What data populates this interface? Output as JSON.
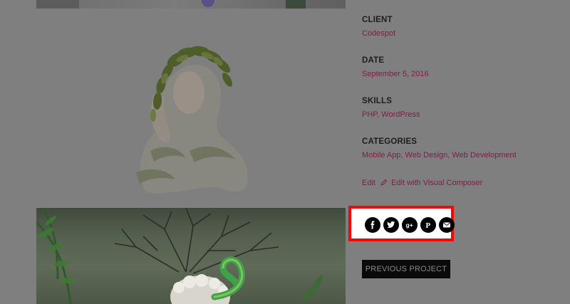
{
  "project_meta": {
    "client": {
      "label": "CLIENT",
      "value": "Codespot"
    },
    "date": {
      "label": "DATE",
      "value": "September 5, 2016"
    },
    "skills": {
      "label": "SKILLS",
      "value": "PHP, WordPress"
    },
    "categories": {
      "label": "CATEGORIES",
      "value": "Mobile App, Web Design, Web Development"
    }
  },
  "edit": {
    "edit_label": "Edit",
    "visual_composer_label": "Edit with Visual Composer"
  },
  "share": {
    "icons": [
      "facebook-icon",
      "twitter-icon",
      "google-plus-icon",
      "pinterest-icon",
      "email-icon"
    ],
    "highlight_color": "#ff0000"
  },
  "navigation": {
    "previous_label": "PREVIOUS PROJECT"
  },
  "colors": {
    "accent": "#7a1f45",
    "label": "#1d1d1d",
    "overlay_bg": "#7f7f7f",
    "button_bg": "#0a0a0a"
  }
}
